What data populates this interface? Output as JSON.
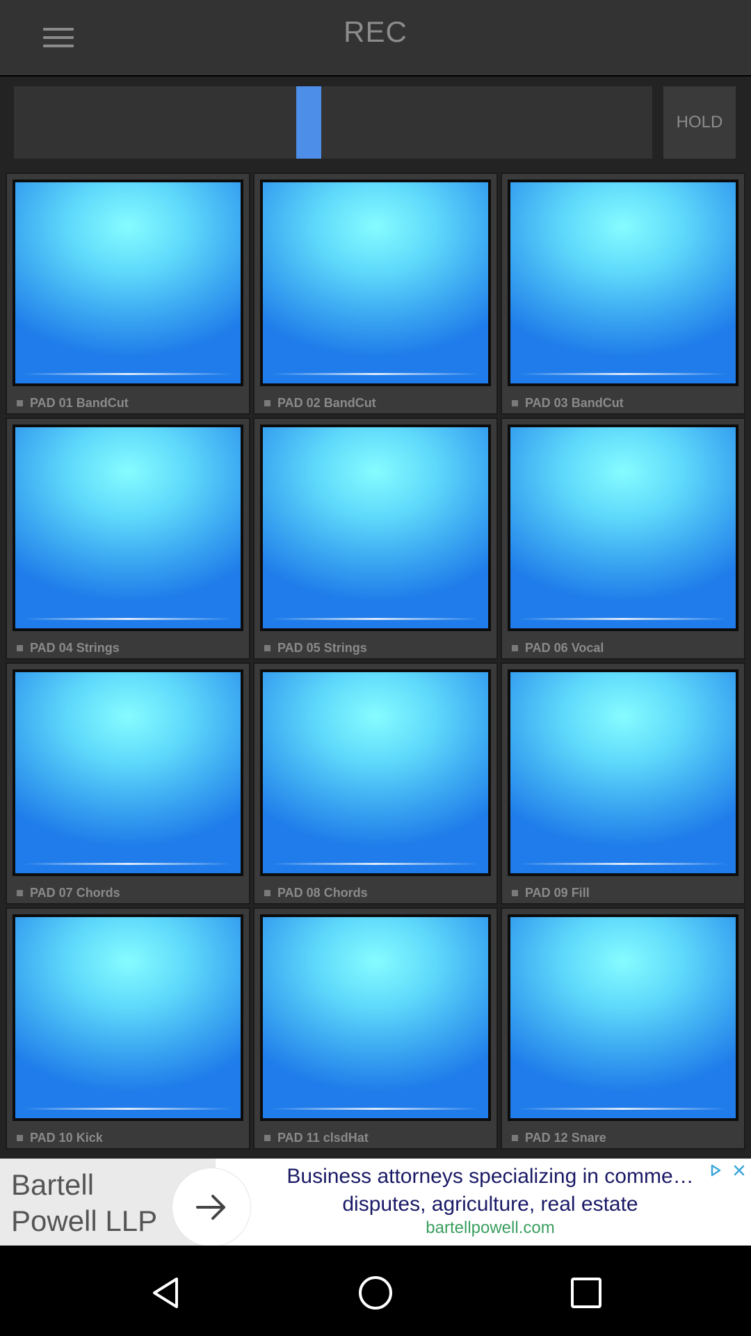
{
  "app_bar": {
    "title": "REC",
    "menu_icon": "hamburger-menu-icon"
  },
  "controls": {
    "slider_level_percent": 46,
    "hold_label": "HOLD"
  },
  "pads": [
    {
      "label": "PAD 01 BandCut"
    },
    {
      "label": "PAD 02 BandCut"
    },
    {
      "label": "PAD 03 BandCut"
    },
    {
      "label": "PAD 04 Strings"
    },
    {
      "label": "PAD 05 Strings"
    },
    {
      "label": "PAD 06 Vocal"
    },
    {
      "label": "PAD 07 Chords"
    },
    {
      "label": "PAD 08 Chords"
    },
    {
      "label": "PAD 09 Fill"
    },
    {
      "label": "PAD 10 Kick"
    },
    {
      "label": "PAD 11 clsdHat"
    },
    {
      "label": "PAD 12 Snare"
    }
  ],
  "ad": {
    "logo_line1": "Bartell",
    "logo_line2": "Powell LLP",
    "headline": "Business attorneys specializing in comme… disputes, agriculture, real estate",
    "url": "bartellpowell.com",
    "arrow_icon": "arrow-right-icon",
    "choices_icon": "ad-choices-icon",
    "close_icon": "close-icon"
  },
  "nav": {
    "back_icon": "back-triangle-icon",
    "home_icon": "home-circle-icon",
    "recents_icon": "recents-square-icon"
  },
  "colors": {
    "app_bar": "#333333",
    "slider_thumb": "#4c8ee8",
    "pad_light": "#86fcff",
    "pad_dark": "#1f7cea",
    "ad_headline": "#1a1a66",
    "ad_url": "#3a9e5f"
  }
}
